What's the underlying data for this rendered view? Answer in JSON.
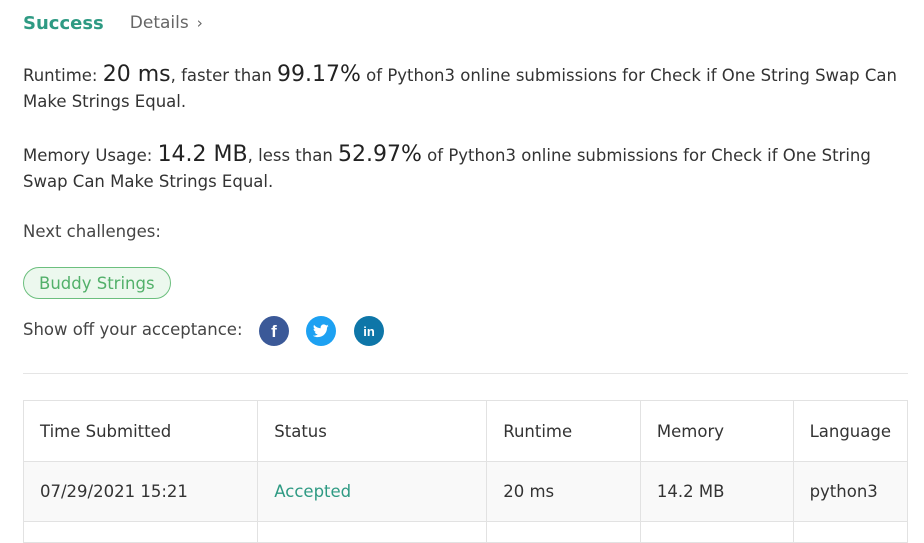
{
  "header": {
    "status": "Success",
    "details_label": "Details",
    "details_chevron": "›"
  },
  "runtime": {
    "label": "Runtime: ",
    "value": "20 ms",
    "comparison_text": ", faster than ",
    "percent": "99.17%",
    "tail": " of Python3 online submissions for Check if One String Swap Can Make Strings Equal."
  },
  "memory": {
    "label": "Memory Usage: ",
    "value": "14.2 MB",
    "comparison_text": ", less than ",
    "percent": "52.97%",
    "tail": " of Python3 online submissions for Check if One String Swap Can Make Strings Equal."
  },
  "next_challenges": {
    "label": "Next challenges:",
    "items": [
      "Buddy Strings"
    ]
  },
  "share": {
    "label": "Show off your acceptance:",
    "icons": [
      "facebook-icon",
      "twitter-icon",
      "linkedin-icon"
    ]
  },
  "submissions": {
    "columns": [
      "Time Submitted",
      "Status",
      "Runtime",
      "Memory",
      "Language"
    ],
    "rows": [
      {
        "time": "07/29/2021 15:21",
        "status": "Accepted",
        "runtime": "20 ms",
        "memory": "14.2 MB",
        "language": "python3"
      }
    ]
  },
  "colors": {
    "success": "#2e9a83",
    "pill_border": "#6cbf7e",
    "pill_bg": "#ecf8ee",
    "facebook": "#3b5998",
    "twitter": "#1da1f2",
    "linkedin": "#0e76a8"
  }
}
